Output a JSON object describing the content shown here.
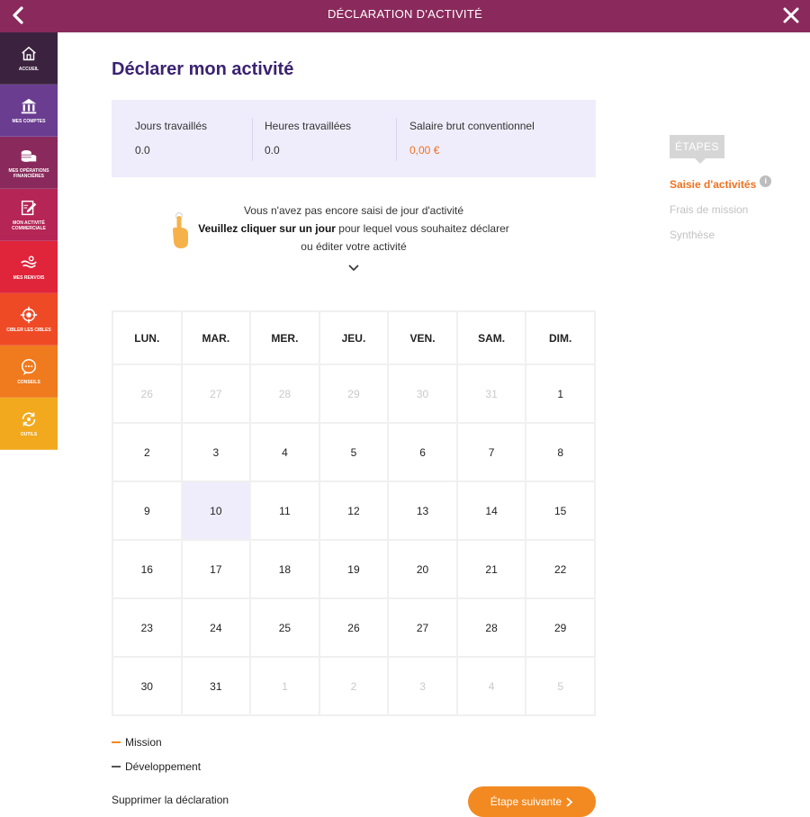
{
  "header": {
    "title": "DÉCLARATION D'ACTIVITÉ"
  },
  "sidebar": {
    "items": [
      {
        "label": "ACCUEIL",
        "icon": "home-icon",
        "color": "#3b2340"
      },
      {
        "label": "MES COMPTES",
        "icon": "bank-icon",
        "color": "#6a3d91"
      },
      {
        "label": "MES OPÉRATIONS FINANCIÈRES",
        "icon": "coins-icon",
        "color": "#8a2a5c"
      },
      {
        "label": "MON ACTIVITÉ COMMERCIALE",
        "icon": "edit-icon",
        "color": "#b52556"
      },
      {
        "label": "MES RENVOIS",
        "icon": "handshake-icon",
        "color": "#e0243a"
      },
      {
        "label": "CIBLER LES CIBLES",
        "icon": "target-icon",
        "color": "#ef4a26"
      },
      {
        "label": "CONSEILS",
        "icon": "chat-icon",
        "color": "#f07a1e"
      },
      {
        "label": "OUTILS",
        "icon": "refresh-icon",
        "color": "#f2a91e"
      }
    ]
  },
  "page": {
    "title": "Déclarer mon activité"
  },
  "stats": [
    {
      "label": "Jours travaillés",
      "value": "0.0",
      "value_color": "#333333"
    },
    {
      "label": "Heures travaillées",
      "value": "0.0",
      "value_color": "#333333"
    },
    {
      "label": "Salaire brut conventionnel",
      "value": "0,00 €",
      "value_color": "#f0711f"
    }
  ],
  "hint": {
    "line1": "Vous n'avez pas encore saisi de jour d'activité",
    "line2_bold": "Veuillez cliquer sur un jour",
    "line2_rest": " pour lequel vous souhaitez déclarer",
    "line3": "ou éditer votre activité"
  },
  "calendar": {
    "weekdays": [
      "LUN.",
      "MAR.",
      "MER.",
      "JEU.",
      "VEN.",
      "SAM.",
      "DIM."
    ],
    "weeks": [
      [
        {
          "d": "26",
          "m": true
        },
        {
          "d": "27",
          "m": true
        },
        {
          "d": "28",
          "m": true
        },
        {
          "d": "29",
          "m": true
        },
        {
          "d": "30",
          "m": true
        },
        {
          "d": "31",
          "m": true
        },
        {
          "d": "1"
        }
      ],
      [
        {
          "d": "2"
        },
        {
          "d": "3"
        },
        {
          "d": "4"
        },
        {
          "d": "5"
        },
        {
          "d": "6"
        },
        {
          "d": "7"
        },
        {
          "d": "8"
        }
      ],
      [
        {
          "d": "9"
        },
        {
          "d": "10",
          "sel": true
        },
        {
          "d": "11"
        },
        {
          "d": "12"
        },
        {
          "d": "13"
        },
        {
          "d": "14"
        },
        {
          "d": "15"
        }
      ],
      [
        {
          "d": "16"
        },
        {
          "d": "17"
        },
        {
          "d": "18"
        },
        {
          "d": "19"
        },
        {
          "d": "20"
        },
        {
          "d": "21"
        },
        {
          "d": "22"
        }
      ],
      [
        {
          "d": "23"
        },
        {
          "d": "24"
        },
        {
          "d": "25"
        },
        {
          "d": "26"
        },
        {
          "d": "27"
        },
        {
          "d": "28"
        },
        {
          "d": "29"
        }
      ],
      [
        {
          "d": "30"
        },
        {
          "d": "31"
        },
        {
          "d": "1",
          "m": true
        },
        {
          "d": "2",
          "m": true
        },
        {
          "d": "3",
          "m": true
        },
        {
          "d": "4",
          "m": true
        },
        {
          "d": "5",
          "m": true
        }
      ]
    ]
  },
  "legend": [
    {
      "label": "Mission",
      "color": "#f28a21"
    },
    {
      "label": "Développement",
      "color": "#555555"
    }
  ],
  "footer": {
    "delete_label": "Supprimer la déclaration",
    "next_label": "Étape suivante"
  },
  "steps": {
    "title": "ÉTAPES",
    "items": [
      {
        "label": "Saisie d'activités",
        "active": true
      },
      {
        "label": "Frais de mission",
        "active": false
      },
      {
        "label": "Synthèse",
        "active": false
      }
    ]
  },
  "colors": {
    "header": "#8a2a5c",
    "accent": "#f28a21",
    "title": "#3a2272",
    "panel": "#efedfb"
  }
}
